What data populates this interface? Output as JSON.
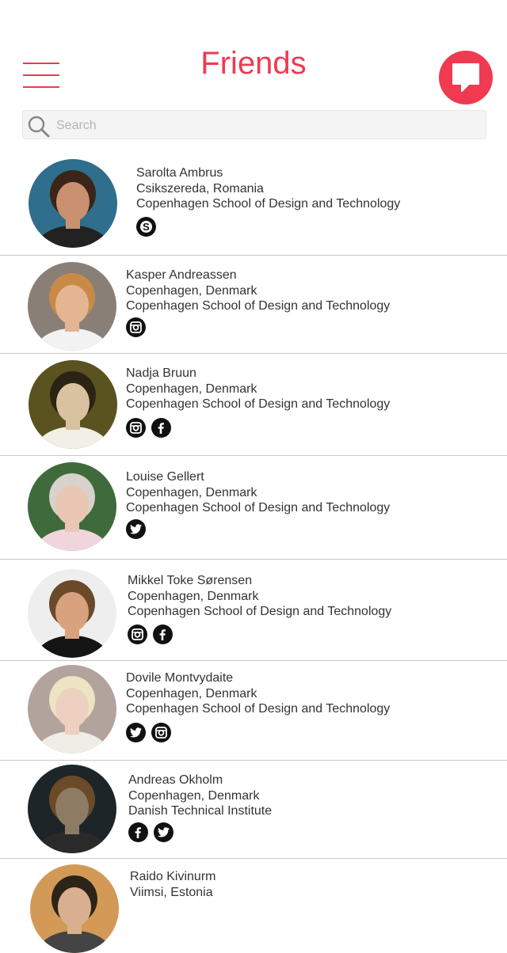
{
  "header": {
    "title": "Friends"
  },
  "search": {
    "placeholder": "Search"
  },
  "colors": {
    "accent": "#ef3a52",
    "divider": "#c8c8c8",
    "icon": "#111111"
  },
  "friends": [
    {
      "name": "Sarolta Ambrus",
      "location": "Csikszereda, Romania",
      "school": "Copenhagen School of Design and Technology",
      "socials": [
        "skype-icon"
      ]
    },
    {
      "name": "Kasper Andreassen",
      "location": "Copenhagen, Denmark",
      "school": "Copenhagen School of Design and Technology",
      "socials": [
        "instagram-icon"
      ]
    },
    {
      "name": "Nadja Bruun",
      "location": "Copenhagen, Denmark",
      "school": "Copenhagen School of Design and Technology",
      "socials": [
        "instagram-icon",
        "facebook-icon"
      ]
    },
    {
      "name": "Louise Gellert",
      "location": "Copenhagen, Denmark",
      "school": "Copenhagen School of Design and Technology",
      "socials": [
        "twitter-icon"
      ]
    },
    {
      "name": "Mikkel Toke Sørensen",
      "location": "Copenhagen, Denmark",
      "school": "Copenhagen School of Design and Technology",
      "socials": [
        "instagram-icon",
        "facebook-icon"
      ]
    },
    {
      "name": "Dovile Montvydaite",
      "location": "Copenhagen, Denmark",
      "school": "Copenhagen School of Design and Technology",
      "socials": [
        "twitter-icon",
        "instagram-icon"
      ]
    },
    {
      "name": "Andreas Okholm",
      "location": "Copenhagen, Denmark",
      "school": "Danish Technical Institute",
      "socials": [
        "facebook-icon",
        "twitter-icon"
      ]
    },
    {
      "name": "Raido Kivinurm",
      "location": "Viimsi, Estonia",
      "school": "",
      "socials": []
    }
  ]
}
